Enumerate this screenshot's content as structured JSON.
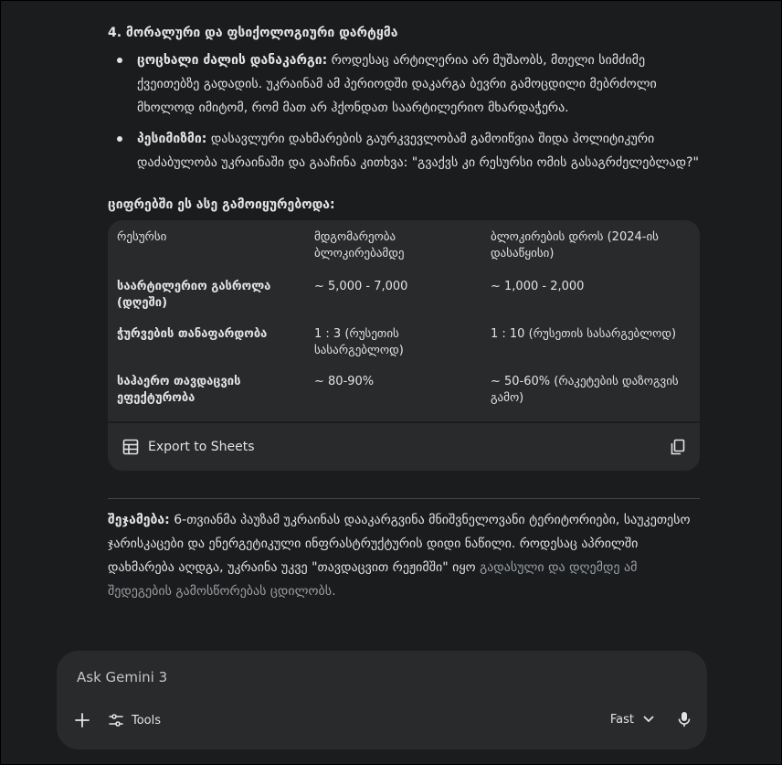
{
  "section": {
    "heading": "4. მორალური და ფსიქოლოგიური დარტყმა",
    "bullets": [
      {
        "title": "ცოცხალი ძალის დანაკარგი:",
        "text": " როდესაც არტილერია არ მუშაობს, მთელი სიმძიმე ქვეითებზე გადადის. უკრაინამ ამ პერიოდში დაკარგა ბევრი გამოცდილი მებრძოლი მხოლოდ იმიტომ, რომ მათ არ ჰქონდათ საარტილერიო მხარდაჭერა."
      },
      {
        "title": "პესიმიზმი:",
        "text": " დასავლური დახმარების გაურკვევლობამ გამოიწვია შიდა პოლიტიკური დაძაბულობა უკრაინაში და გააჩინა კითხვა: \"გვაქვს კი რესურსი ომის გასაგრძელებლად?\""
      }
    ]
  },
  "table": {
    "heading": "ციფრებში ეს ასე გამოიყურებოდა:",
    "headers": [
      "რესურსი",
      "მდგომარეობა ბლოკირებამდე",
      "ბლოკირების დროს (2024-ის დასაწყისი)"
    ],
    "rows": [
      [
        "საარტილერიო გასროლა (დღეში)",
        "~ 5,000 - 7,000",
        "~ 1,000 - 2,000"
      ],
      [
        "ჭურვების თანაფარდობა",
        "1 : 3 (რუსეთის სასარგებლოდ)",
        "1 : 10 (რუსეთის სასარგებლოდ)"
      ],
      [
        "საჰაერო თავდაცვის ეფექტურობა",
        "~ 80-90%",
        "~ 50-60% (რაკეტების დაზოგვის გამო)"
      ]
    ],
    "export_label": "Export to Sheets"
  },
  "summary": {
    "title": "შეჯამება:",
    "text": " 6-თვიანმა პაუზამ უკრაინას დააკარგვინა მნიშვნელოვანი ტერიტორიები, საუკეთესო ჯარისკაცები და ენერგეტიკული ინფრასტრუქტურის დიდი ნაწილი. როდესაც აპრილში დახმარება აღდგა, უკრაინა უკვე \"თავდაცვით რეჟიმში\" იყო",
    "text_faded": "გადასული და დღემდე ამ შედეგების გამოსწორებას ცდილობს."
  },
  "composer": {
    "placeholder": "Ask Gemini 3",
    "tools_label": "Tools",
    "mode_label": "Fast"
  },
  "icons": {
    "add": "plus-icon",
    "tools": "tune-icon",
    "mode_caret": "chevron-down-icon",
    "mic": "microphone-icon",
    "sheets": "sheets-table-icon",
    "copy": "copy-icon"
  }
}
